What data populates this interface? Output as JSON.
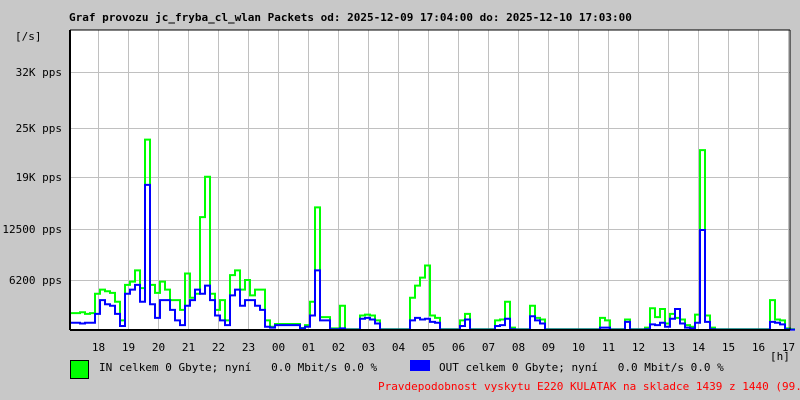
{
  "chart_data": {
    "type": "line",
    "title": "Graf provozu jc_fryba_cl_wlan Packets od: 2025-12-09 17:04:00 do: 2025-12-10 17:03:00",
    "ylabel": "[/s]",
    "xlabel": "[h]",
    "ylim": [
      0,
      37200
    ],
    "yticks": [
      {
        "value": 6200,
        "label": "6200 pps"
      },
      {
        "value": 12500,
        "label": "12500 pps"
      },
      {
        "value": 19000,
        "label": "19K pps"
      },
      {
        "value": 25000,
        "label": "25K pps"
      },
      {
        "value": 32000,
        "label": "32K pps"
      }
    ],
    "xticks": [
      {
        "minutes": 56,
        "label": "18"
      },
      {
        "minutes": 116,
        "label": "19"
      },
      {
        "minutes": 176,
        "label": "20"
      },
      {
        "minutes": 236,
        "label": "21"
      },
      {
        "minutes": 296,
        "label": "22"
      },
      {
        "minutes": 356,
        "label": "23"
      },
      {
        "minutes": 416,
        "label": "00"
      },
      {
        "minutes": 476,
        "label": "01"
      },
      {
        "minutes": 536,
        "label": "02"
      },
      {
        "minutes": 596,
        "label": "03"
      },
      {
        "minutes": 656,
        "label": "04"
      },
      {
        "minutes": 716,
        "label": "05"
      },
      {
        "minutes": 776,
        "label": "06"
      },
      {
        "minutes": 836,
        "label": "07"
      },
      {
        "minutes": 896,
        "label": "08"
      },
      {
        "minutes": 956,
        "label": "09"
      },
      {
        "minutes": 1016,
        "label": "10"
      },
      {
        "minutes": 1076,
        "label": "11"
      },
      {
        "minutes": 1136,
        "label": "12"
      },
      {
        "minutes": 1196,
        "label": "13"
      },
      {
        "minutes": 1256,
        "label": "14"
      },
      {
        "minutes": 1316,
        "label": "15"
      },
      {
        "minutes": 1376,
        "label": "16"
      },
      {
        "minutes": 1436,
        "label": "17"
      }
    ],
    "x_range_minutes": [
      0,
      1440
    ],
    "sample_interval_minutes": 10,
    "grid": true,
    "series": [
      {
        "name": "IN",
        "color": "#00ff00",
        "values": [
          2100,
          2100,
          2200,
          2000,
          2100,
          4500,
          5000,
          4800,
          4600,
          3500,
          1200,
          5600,
          6000,
          7400,
          5200,
          23600,
          5600,
          4600,
          6000,
          5000,
          3700,
          3700,
          2500,
          7000,
          4000,
          4500,
          14000,
          19000,
          4500,
          2500,
          3700,
          1200,
          6800,
          7400,
          5000,
          6200,
          4300,
          5000,
          5000,
          1200,
          400,
          750,
          750,
          750,
          750,
          750,
          250,
          600,
          3500,
          15200,
          1600,
          1600,
          200,
          200,
          3000,
          100,
          100,
          100,
          1800,
          1900,
          1800,
          1200,
          100,
          100,
          100,
          100,
          100,
          100,
          4000,
          5500,
          6500,
          8000,
          1800,
          1500,
          100,
          100,
          100,
          100,
          1200,
          2000,
          100,
          100,
          100,
          100,
          100,
          1200,
          1300,
          3500,
          300,
          100,
          100,
          100,
          3000,
          1500,
          1300,
          100,
          100,
          100,
          100,
          100,
          100,
          100,
          100,
          100,
          100,
          100,
          1500,
          1200,
          100,
          100,
          100,
          1300,
          100,
          100,
          100,
          300,
          2700,
          1600,
          2600,
          800,
          2000,
          1500,
          1300,
          600,
          400,
          1900,
          22300,
          1800,
          300,
          100,
          100,
          100,
          100,
          100,
          100,
          100,
          100,
          100,
          100,
          100,
          3700,
          1300,
          1200,
          200,
          100
        ]
      },
      {
        "name": "OUT",
        "color": "#0000ff",
        "values": [
          900,
          900,
          800,
          900,
          900,
          2000,
          3700,
          3200,
          3000,
          2000,
          500,
          4500,
          5000,
          5600,
          3500,
          18000,
          3200,
          1500,
          3700,
          3700,
          2500,
          1200,
          600,
          3000,
          3700,
          5000,
          4500,
          5500,
          3700,
          1800,
          1200,
          600,
          4300,
          5000,
          3000,
          3700,
          3700,
          3000,
          2500,
          400,
          300,
          600,
          600,
          600,
          600,
          600,
          200,
          400,
          1800,
          7400,
          1200,
          1200,
          100,
          100,
          200,
          50,
          50,
          50,
          1400,
          1500,
          1300,
          800,
          50,
          50,
          50,
          50,
          50,
          50,
          1200,
          1500,
          1300,
          1400,
          1000,
          900,
          50,
          50,
          50,
          50,
          500,
          1300,
          50,
          50,
          50,
          50,
          50,
          500,
          600,
          1400,
          100,
          50,
          50,
          50,
          1700,
          1200,
          800,
          50,
          50,
          50,
          50,
          50,
          50,
          50,
          50,
          50,
          50,
          50,
          300,
          300,
          50,
          50,
          50,
          1000,
          50,
          50,
          50,
          100,
          700,
          600,
          900,
          400,
          1400,
          2600,
          800,
          300,
          200,
          900,
          12400,
          1000,
          100,
          50,
          50,
          50,
          50,
          50,
          50,
          50,
          50,
          50,
          50,
          50,
          1000,
          900,
          700,
          100,
          50
        ]
      }
    ]
  },
  "legend": {
    "in_text": "IN celkem 0 Gbyte; nyní   0.0 Mbit/s 0.0 %",
    "out_text": "OUT celkem 0 Gbyte; nyní   0.0 Mbit/s 0.0 %"
  },
  "note": "Pravdepodobnost vyskytu E220 KULATAK na skladce 1439 z 1440 (99.9 %)"
}
